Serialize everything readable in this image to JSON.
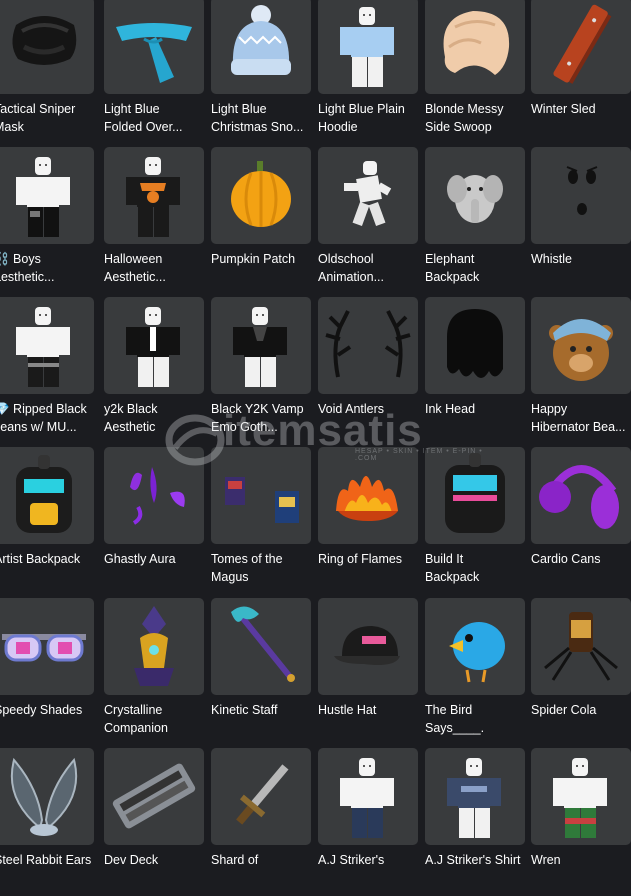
{
  "items": [
    {
      "label": "Tactical Sniper\nMask",
      "icon": "tactical-mask-icon"
    },
    {
      "label": "Light Blue\nFolded Over...",
      "icon": "blue-scarf-icon"
    },
    {
      "label": "Light Blue\nChristmas Sno...",
      "icon": "beanie-icon"
    },
    {
      "label": "Light Blue Plain\nHoodie",
      "icon": "hoodie-avatar-icon"
    },
    {
      "label": "Blonde Messy\nSide Swoop",
      "icon": "blonde-hair-icon"
    },
    {
      "label": "Winter Sled",
      "icon": "sled-icon"
    },
    {
      "label": "⛓️ Boys\naesthetic...",
      "icon": "avatar-outfit-icon"
    },
    {
      "label": "Halloween\nAesthetic...",
      "icon": "halloween-shirt-icon"
    },
    {
      "label": "Pumpkin Patch",
      "icon": "pumpkin-icon"
    },
    {
      "label": "Oldschool\nAnimation...",
      "icon": "animation-avatar-icon"
    },
    {
      "label": "Elephant\nBackpack",
      "icon": "elephant-icon"
    },
    {
      "label": "Whistle",
      "icon": "whistle-face-icon"
    },
    {
      "label": "💎 Ripped Black\nJeans w/ MU...",
      "icon": "black-jeans-avatar-icon"
    },
    {
      "label": "y2k Black\nAesthetic",
      "icon": "black-shirt-avatar-icon"
    },
    {
      "label": "Black Y2K Vamp\nEmo Goth...",
      "icon": "black-y2k-avatar-icon"
    },
    {
      "label": "Void Antlers",
      "icon": "antlers-icon"
    },
    {
      "label": "Ink Head",
      "icon": "ink-head-icon"
    },
    {
      "label": "Happy\nHibernator Bea...",
      "icon": "bear-icon"
    },
    {
      "label": "Artist Backpack",
      "icon": "artist-backpack-icon"
    },
    {
      "label": "Ghastly Aura",
      "icon": "purple-aura-icon"
    },
    {
      "label": "Tomes of the\nMagus",
      "icon": "tomes-icon"
    },
    {
      "label": "Ring of Flames",
      "icon": "flames-icon"
    },
    {
      "label": "Build It\nBackpack",
      "icon": "build-backpack-icon"
    },
    {
      "label": "Cardio Cans",
      "icon": "headphones-icon"
    },
    {
      "label": "Speedy Shades",
      "icon": "shades-icon"
    },
    {
      "label": "Crystalline\nCompanion",
      "icon": "crystal-companion-icon"
    },
    {
      "label": "Kinetic Staff",
      "icon": "staff-icon"
    },
    {
      "label": "Hustle Hat",
      "icon": "cap-icon"
    },
    {
      "label": "The Bird\nSays____.",
      "icon": "blue-bird-icon"
    },
    {
      "label": "Spider Cola",
      "icon": "spider-cola-icon"
    },
    {
      "label": "Steel Rabbit Ears",
      "icon": "rabbit-ears-icon"
    },
    {
      "label": "Dev Deck",
      "icon": "dev-deck-icon"
    },
    {
      "label": "Shard of",
      "icon": "shard-sword-icon"
    },
    {
      "label": "A.J Striker's",
      "icon": "striker-pants-avatar-icon"
    },
    {
      "label": "A.J Striker's Shirt",
      "icon": "striker-shirt-avatar-icon"
    },
    {
      "label": "Wren",
      "icon": "wren-avatar-icon"
    }
  ],
  "watermark": {
    "text": "itemsatis",
    "subtitle": "HESAP • SKIN • ITEM • E-PIN • .COM"
  },
  "colors": {
    "page_bg": "#1b1c20",
    "tile_bg": "#393b3d",
    "text": "#ffffff"
  }
}
